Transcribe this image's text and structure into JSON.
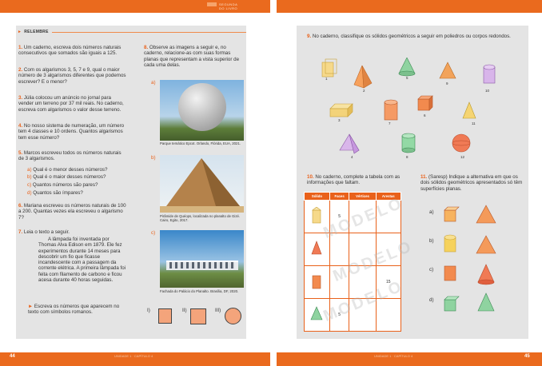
{
  "header": {
    "brand_line1": "SEGUNDA",
    "brand_line2": "DO LIVRO"
  },
  "left": {
    "section": "RELEMBRE",
    "q1": "Um caderno, escreva dois números naturais consecutivos que somados são iguais a 125.",
    "q2": "Com os algarismos 3, 5, 7 e 9, qual o maior número de 3 algarismos diferentes que podemos escrever? E o menor?",
    "q3": "Júlia colocou um anúncio no jornal para vender um terreno por 37 mil reais. No caderno, escreva com algarismos o valor desse terreno.",
    "q4": "No nosso sistema de numeração, um número tem 4 classes e 10 ordens. Quantos algarismos tem esse número?",
    "q5": "Marcos escreveu todos os números naturais de 3 algarismos.",
    "q5a": "Qual é o menor desses números?",
    "q5b": "Qual é o maior desses números?",
    "q5c": "Quantos números são pares?",
    "q5d": "Quantos são ímpares?",
    "q6": "Mariana escreveu os números naturais de 100 a 200. Quantas vezes ela escreveu o algarismo 7?",
    "q7": "Leia o texto a seguir.",
    "q7text": "A lâmpada foi inventada por Thomas Alva Edison em 1879. Ele fez experimentos durante 14 meses para descobrir um fio que ficasse incandescente com a passagem da corrente elétrica. A primeira lâmpada foi feita com filamento de carbono e ficou acesa durante 40 horas seguidas.",
    "q7b": "Escreva os números que aparecem no texto com símbolos romanos.",
    "q8": "Observe as imagens a seguir e, no caderno, relacione-as com suas formas planas que representam a vista superior de cada uma delas.",
    "cap_a": "Parque temático Epcot. Orlando, Flórida, EUA, 2021.",
    "cap_b": "Pirâmide de Quéops, localizada no planalto de Gizé. Cairo, Egito, 2017.",
    "cap_c": "Fachada do Palácio do Planalto. Brasília, DF, 2020.",
    "opt": [
      "I)",
      "II)",
      "III)"
    ],
    "page_num": "44",
    "run": "UNIDADE 1 · CAPÍTULO 4"
  },
  "right": {
    "q9": "No caderno, classifique os sólidos geométricos a seguir em poliedros ou corpos redondos.",
    "labels": [
      "1",
      "2",
      "3",
      "4",
      "5",
      "6",
      "7",
      "8",
      "9",
      "10",
      "11",
      "12"
    ],
    "q10": "No caderno, complete a tabela com as informações que faltam.",
    "table_head": [
      "Sólido",
      "Faces",
      "Vértices",
      "Arestas"
    ],
    "table_vals": {
      "r1_faces": "5",
      "r3_arestas": "15",
      "r4_faces": "5"
    },
    "q11": "(Saresp) Indique a alternativa em que os dois sólidos geométricos apresentados só têm superfícies planas.",
    "opts": [
      "a)",
      "b)",
      "c)",
      "d)"
    ],
    "watermark": "MODELO",
    "page_num": "45",
    "run": "UNIDADE 1 · CAPÍTULO 4"
  }
}
